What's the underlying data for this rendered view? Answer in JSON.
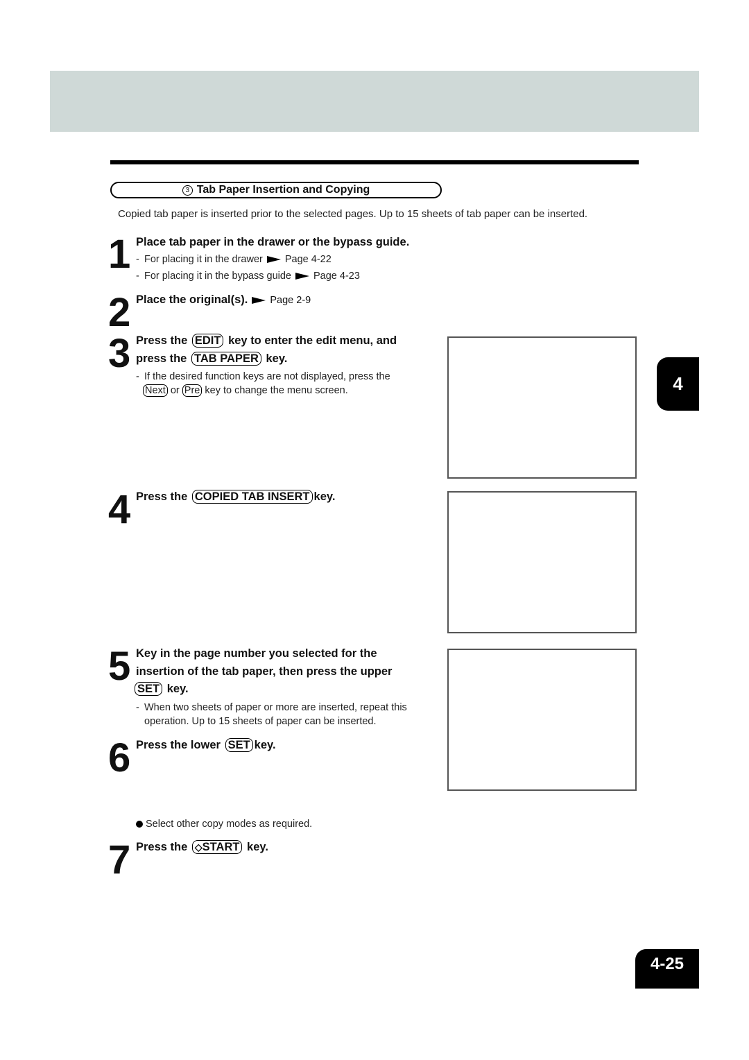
{
  "section": {
    "number": "3",
    "title": "Tab Paper Insertion and Copying",
    "intro": "Copied tab paper is inserted prior to the selected pages. Up to 15 sheets of tab paper can be inserted."
  },
  "steps": [
    {
      "number": "1",
      "title": "Place tab paper in the drawer or the bypass guide.",
      "notes": [
        {
          "text": "For placing it in the drawer",
          "ref": "Page 4-22"
        },
        {
          "text": "For placing it in the bypass guide",
          "ref": "Page 4-23"
        }
      ]
    },
    {
      "number": "2",
      "title": "Place the original(s).",
      "ref": "Page 2-9"
    },
    {
      "number": "3",
      "title_parts": [
        "Press the",
        "EDIT",
        "key to enter the edit menu, and",
        "press the",
        "TAB PAPER",
        "key."
      ],
      "note_parts": [
        "If the desired function keys are not displayed, press the",
        "Next",
        "or",
        "Pre",
        "key to change the menu screen."
      ]
    },
    {
      "number": "4",
      "title_parts": [
        "Press the",
        "COPIED TAB INSERT",
        "key."
      ]
    },
    {
      "number": "5",
      "title_parts": [
        "Key in the page number you selected for the insertion of the tab paper, then press the upper",
        "SET",
        "key."
      ],
      "note": "When two sheets of paper or more are inserted, repeat this operation. Up to 15 sheets of paper can be inserted."
    },
    {
      "number": "6",
      "title_parts": [
        "Press the lower",
        "SET",
        "key."
      ],
      "bullet": "Select other copy modes as required."
    },
    {
      "number": "7",
      "title_parts": [
        "Press the",
        "START",
        "key."
      ]
    }
  ],
  "icons": {
    "arrow": "right-pointer-arrow",
    "start": "start-diamond-icon"
  },
  "chapter_tab": "4",
  "page_number": "4-25",
  "colors": {
    "header_band": "#cfd9d7",
    "tab_bg": "#000000"
  }
}
